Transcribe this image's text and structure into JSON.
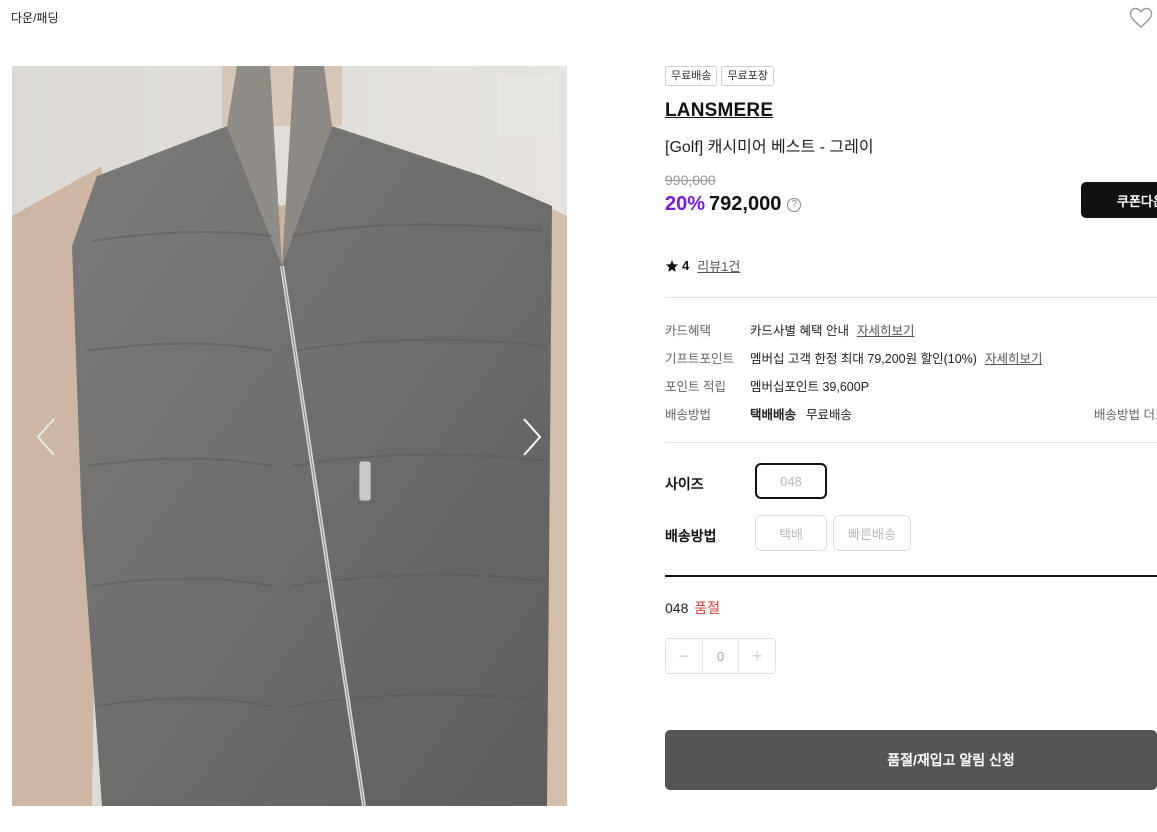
{
  "breadcrumb": "다운/패딩",
  "icons": {
    "wishlist": "heart-outline-icon",
    "prev": "chevron-left-icon",
    "next": "chevron-right-icon",
    "help": "question-circle-icon",
    "star": "star-icon"
  },
  "gallery": {
    "image": "gray-down-vest-photo"
  },
  "product": {
    "tags": [
      "무료배송",
      "무료포장"
    ],
    "brand": "LANSMERE",
    "name": "[Golf] 캐시미어 베스트 - 그레이",
    "original_price": "990,000",
    "discount_rate": "20%",
    "sale_price": "792,000",
    "help_icon_text": "?",
    "coupon_button": "쿠폰다운",
    "rating_score": "4",
    "review_link": "리뷰1건"
  },
  "benefits": [
    {
      "label": "카드혜택",
      "value": "카드사별 혜택 안내",
      "link": "자세히보기"
    },
    {
      "label": "기프트포인트",
      "value": "멤버십 고객 한정 최대 79,200원 할인(10%)",
      "link": "자세히보기"
    },
    {
      "label": "포인트 적립",
      "value": "멤버십포인트 39,600P"
    },
    {
      "label": "배송방법",
      "bold": "택배배송",
      "value": "무료배송",
      "more": "배송방법 더보기"
    }
  ],
  "options": {
    "size_label": "사이즈",
    "size_value": "048",
    "delivery_label": "배송방법",
    "delivery_values": [
      "택배",
      "빠른배송"
    ]
  },
  "stock": {
    "size": "048",
    "status": "품절"
  },
  "quantity": {
    "minus": "−",
    "value": "0",
    "plus": "+"
  },
  "restock_button": "품절/재입고 알림 신청",
  "colors": {
    "accent_purple": "#7a19e0",
    "soldout_red": "#e0413a",
    "button_dark": "#555555"
  }
}
